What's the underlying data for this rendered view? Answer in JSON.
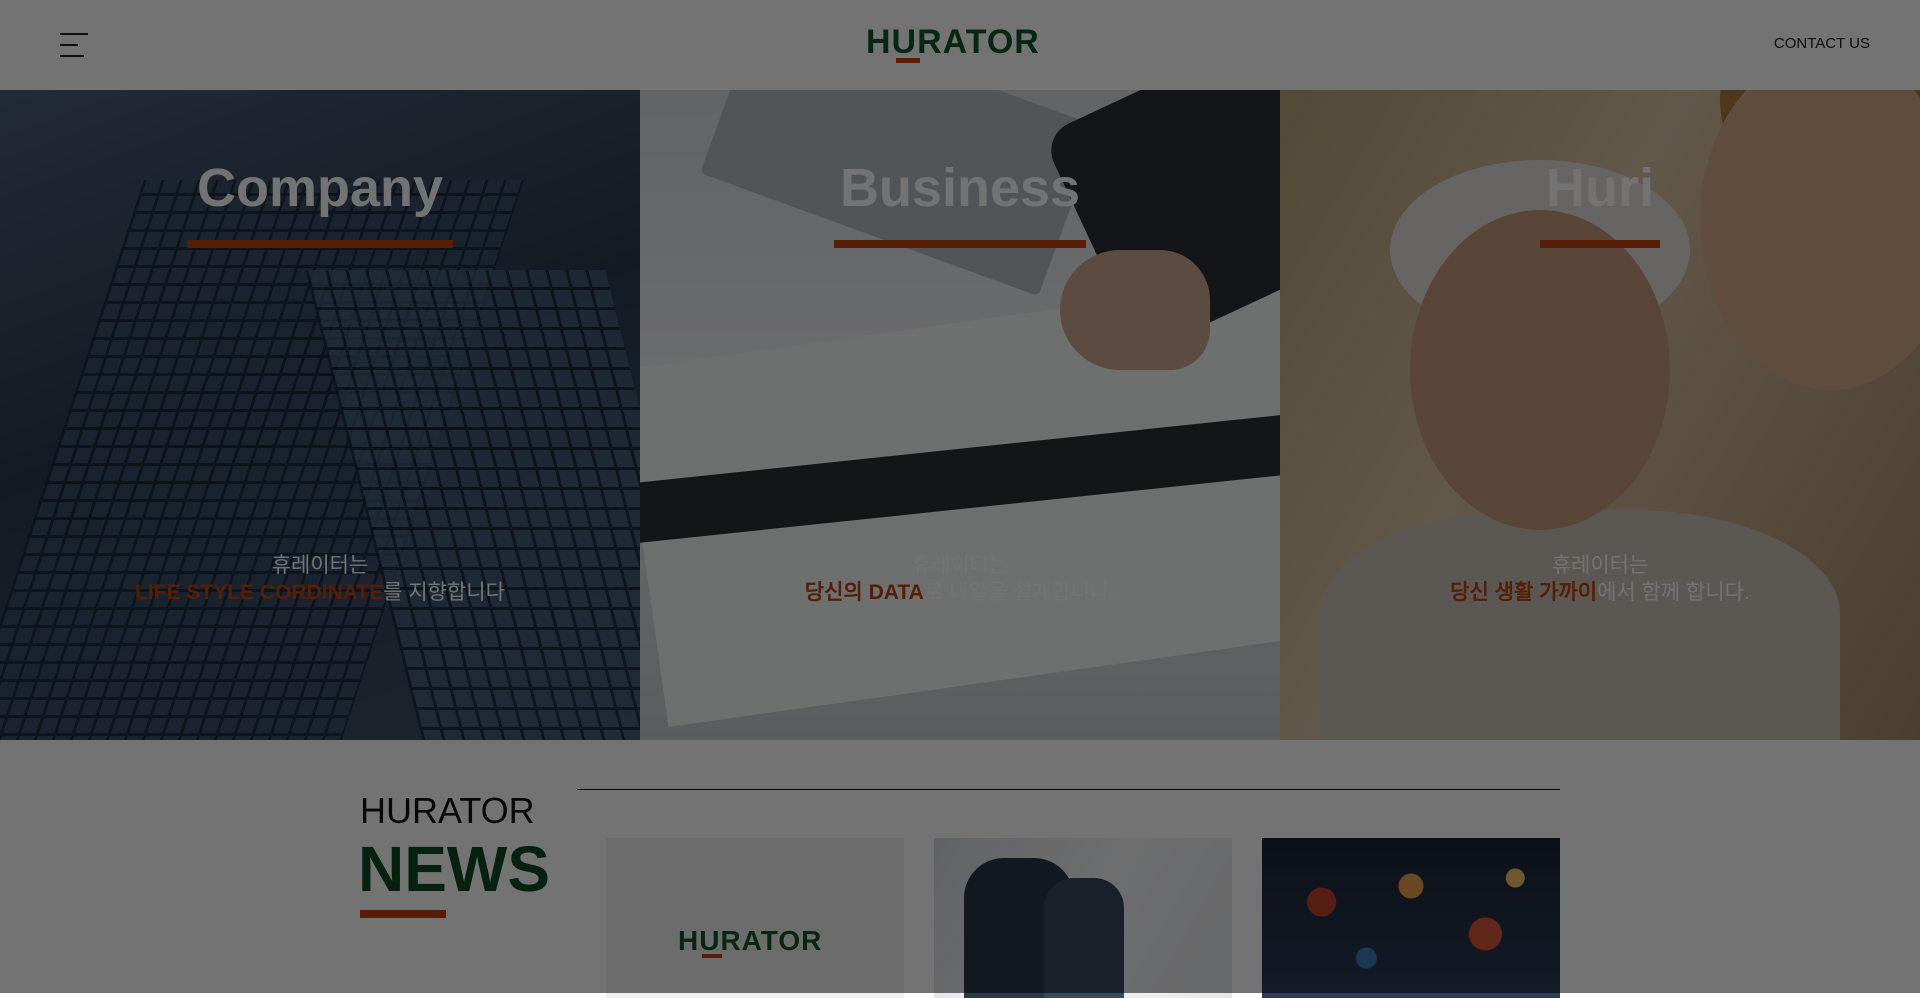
{
  "colors": {
    "accent": "#c1440e",
    "brand_green": "#0f5a2c",
    "news_green": "#0f4a25"
  },
  "header": {
    "menu_icon": "hamburger-menu-icon",
    "logo": "HURATOR",
    "contact_label": "CONTACT US"
  },
  "panels": [
    {
      "title": "Company",
      "line1": "휴레이터는",
      "highlight": "LIFE STYLE CORDINATE",
      "rest": "를 지향합니다"
    },
    {
      "title": "Business",
      "line1": "휴레이터는",
      "highlight": "당신의 DATA",
      "rest": "로 내일을 설계합니다."
    },
    {
      "title": "Huri",
      "line1": "휴레이터는",
      "highlight": "당신 생활 가까이",
      "rest": "에서 함께 합니다."
    }
  ],
  "news": {
    "small": "HURATOR",
    "big": "NEWS",
    "cards": [
      {
        "logo": "HURATOR"
      },
      {},
      {}
    ]
  }
}
